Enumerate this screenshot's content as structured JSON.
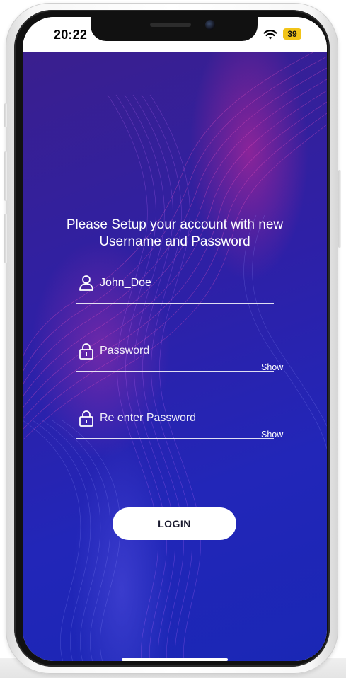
{
  "status_bar": {
    "time": "20:22",
    "battery": "39",
    "icons": [
      "wifi-icon",
      "battery-icon"
    ]
  },
  "setup": {
    "headline_line1": "Please Setup your account with new",
    "headline_line2": "Username and Password",
    "username_value": "John_Doe",
    "password_placeholder": "Password",
    "reenter_placeholder": "Re enter Password",
    "show_label": "Show",
    "login_label": "LOGIN",
    "icons": [
      "user-icon",
      "lock-icon"
    ]
  },
  "colors": {
    "background_top": "#3a1f8e",
    "background_bottom": "#1a27b5",
    "wave_accent": "#d22896",
    "battery": "#f2c418",
    "button": "#ffffff"
  }
}
